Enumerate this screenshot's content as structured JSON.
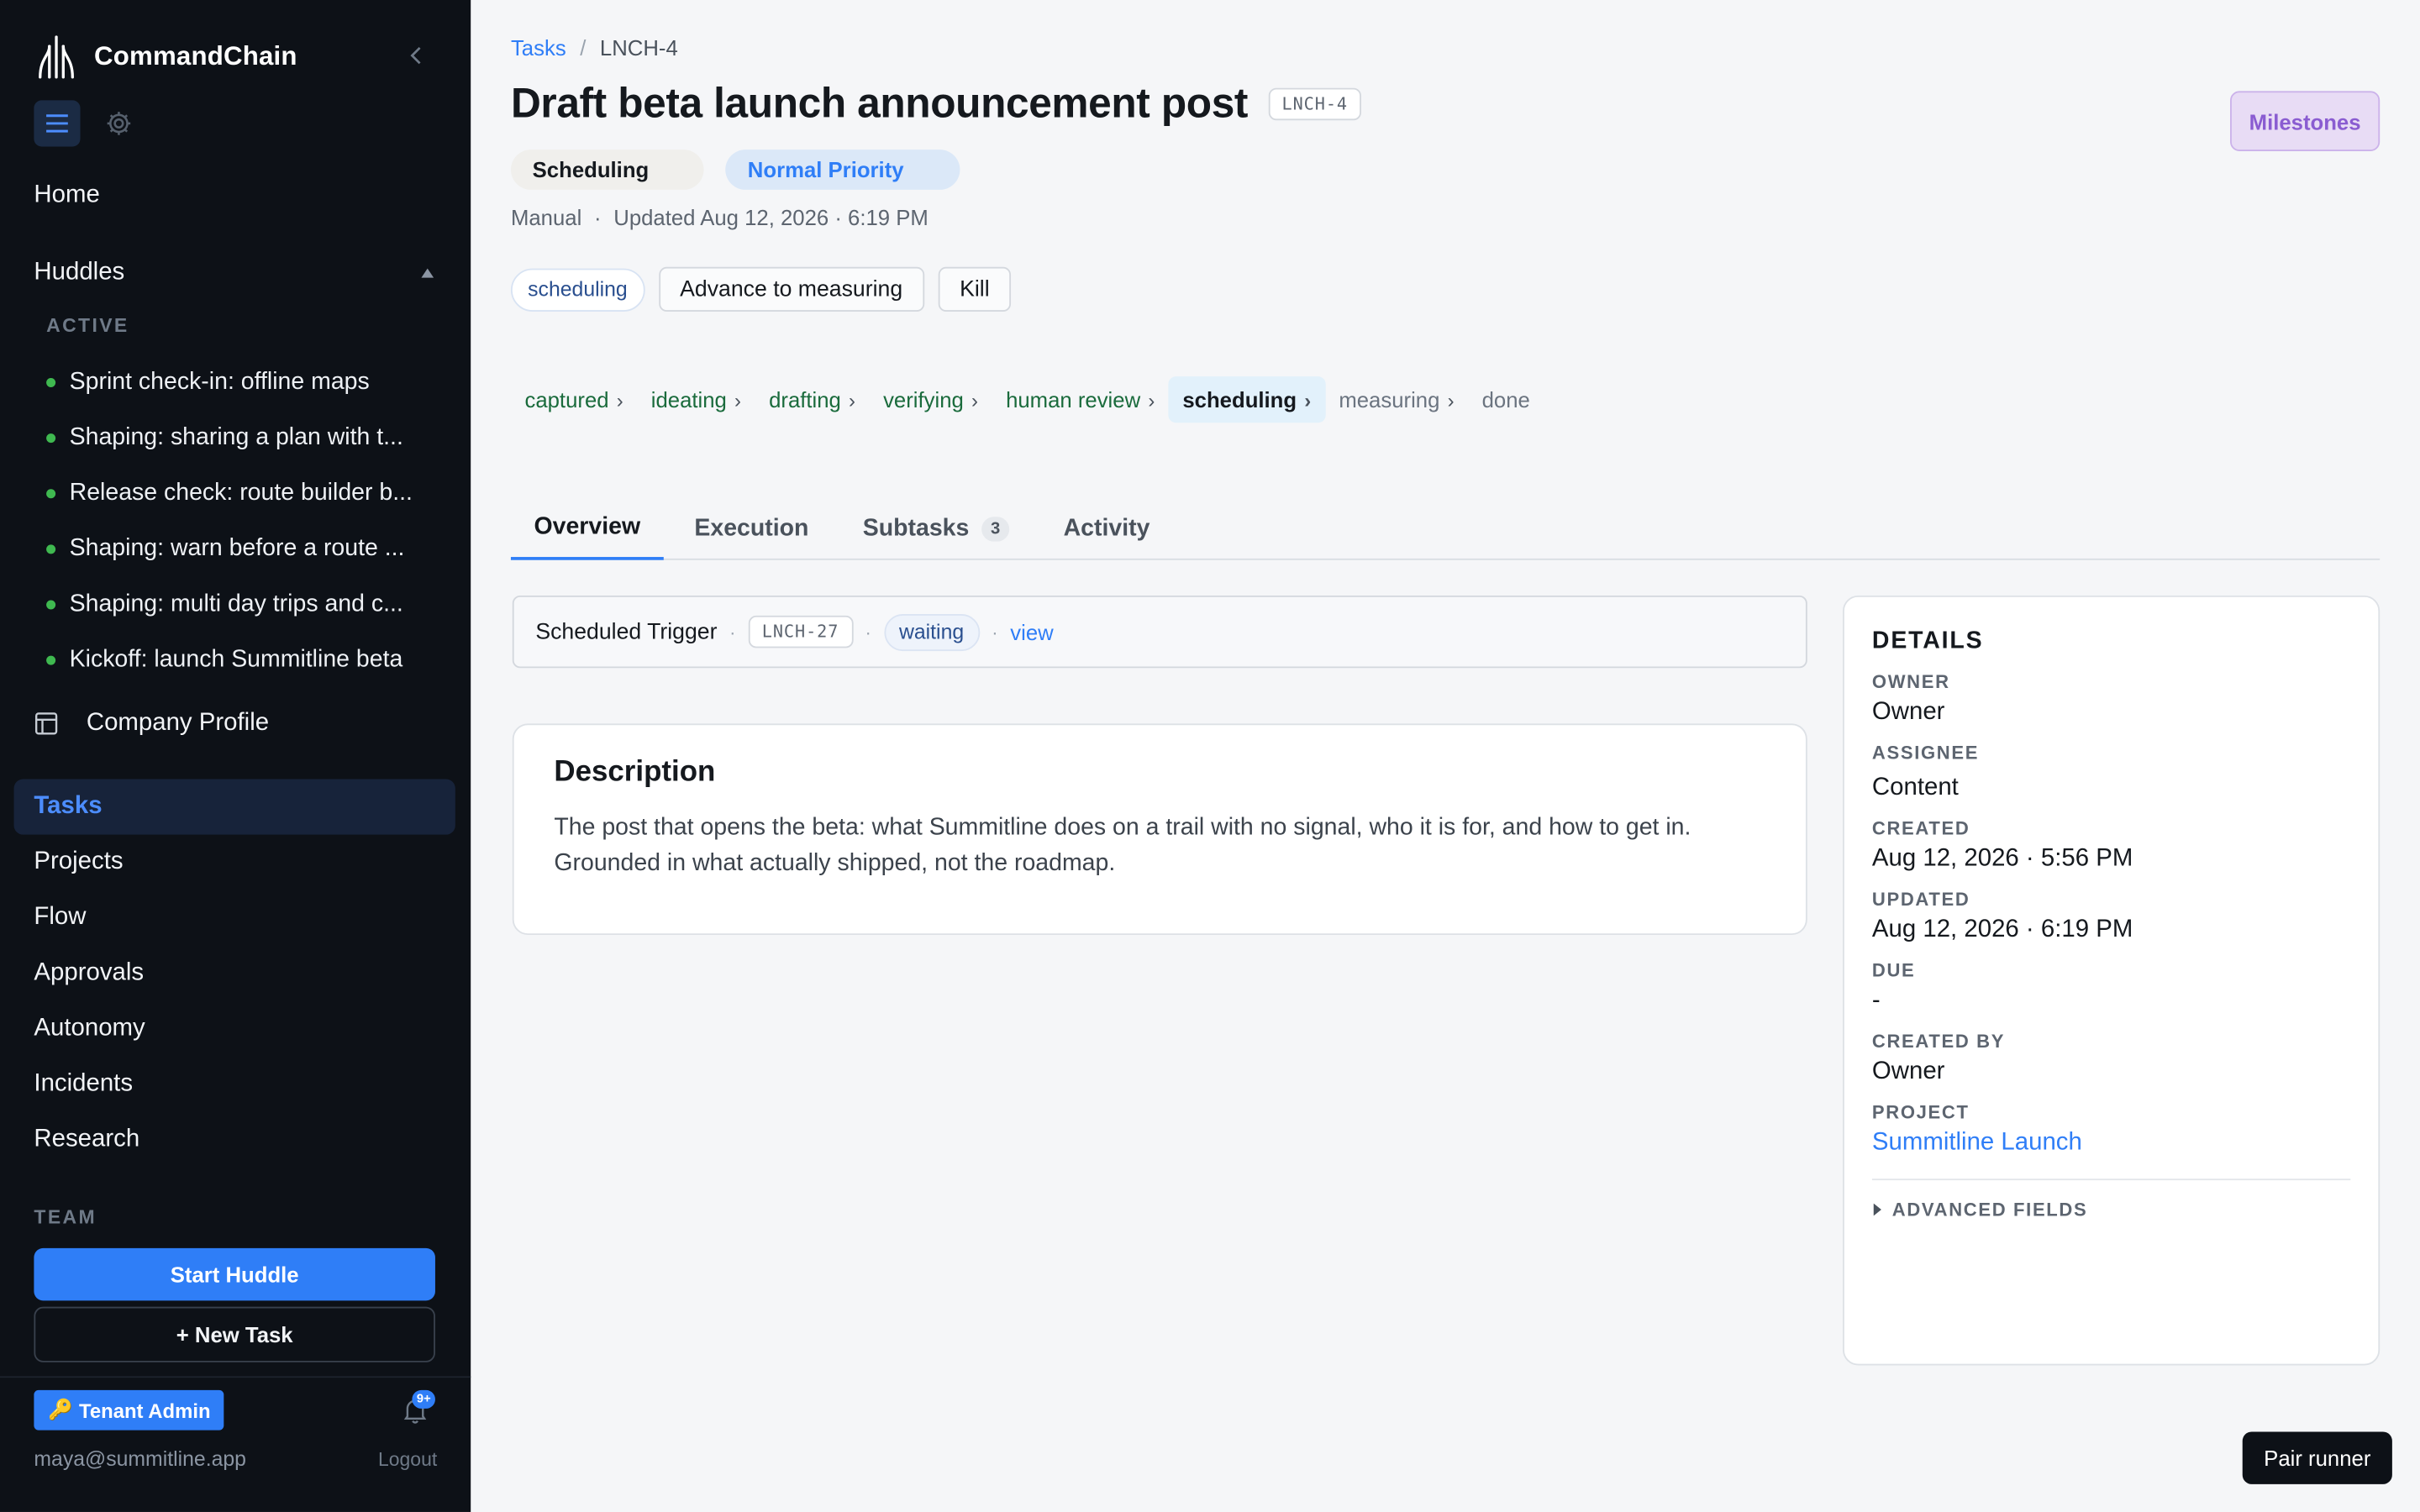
{
  "app": {
    "name": "CommandChain",
    "brand_color": "#2f7ef7"
  },
  "sidebar": {
    "home": "Home",
    "huddles": {
      "label": "Huddles",
      "section": "ACTIVE",
      "items": [
        "Sprint check-in: offline maps",
        "Shaping: sharing a plan with t...",
        "Release check: route builder b...",
        "Shaping: warn before a route ...",
        "Shaping: multi day trips and c...",
        "Kickoff: launch Summitline beta"
      ]
    },
    "company_profile": "Company Profile",
    "nav": [
      "Tasks",
      "Projects",
      "Flow",
      "Approvals",
      "Autonomy",
      "Incidents",
      "Research"
    ],
    "active_nav": "Tasks",
    "team_label": "TEAM",
    "start_huddle": "Start Huddle",
    "new_task": "+ New Task",
    "tenant_badge": "Tenant Admin",
    "notifications": "9+",
    "user_email": "maya@summitline.app",
    "logout": "Logout"
  },
  "breadcrumb": {
    "parent": "Tasks",
    "separator": "/",
    "current": "LNCH-4"
  },
  "task": {
    "title": "Draft beta launch announcement post",
    "id": "LNCH-4",
    "status": "Scheduling",
    "priority": "Normal Priority",
    "source": "Manual",
    "updated": "Updated Aug 12, 2026 · 6:19 PM",
    "tag": "scheduling",
    "advance_button": "Advance to measuring",
    "kill_button": "Kill"
  },
  "milestones_button": "Milestones",
  "pipeline": {
    "stages": [
      "captured",
      "ideating",
      "drafting",
      "verifying",
      "human review",
      "scheduling",
      "measuring",
      "done"
    ],
    "current": "scheduling"
  },
  "tabs": [
    {
      "label": "Overview",
      "badge": ""
    },
    {
      "label": "Execution",
      "badge": ""
    },
    {
      "label": "Subtasks",
      "badge": "3"
    },
    {
      "label": "Activity",
      "badge": ""
    }
  ],
  "trigger": {
    "label": "Scheduled Trigger",
    "id": "LNCH-27",
    "state": "waiting",
    "view": "view"
  },
  "description": {
    "heading": "Description",
    "text": "The post that opens the beta: what Summitline does on a trail with no signal, who it is for, and how to get in. Grounded in what actually shipped, not the roadmap."
  },
  "details": {
    "heading": "DETAILS",
    "owner_label": "OWNER",
    "owner": "Owner",
    "assignee_label": "ASSIGNEE",
    "assignee": "Content",
    "created_label": "CREATED",
    "created": "Aug 12, 2026 · 5:56 PM",
    "updated_label": "UPDATED",
    "updated": "Aug 12, 2026 · 6:19 PM",
    "due_label": "DUE",
    "due": "-",
    "created_by_label": "CREATED BY",
    "created_by": "Owner",
    "project_label": "PROJECT",
    "project": "Summitline Launch",
    "advanced": "ADVANCED FIELDS"
  },
  "pair_runner": "Pair runner"
}
